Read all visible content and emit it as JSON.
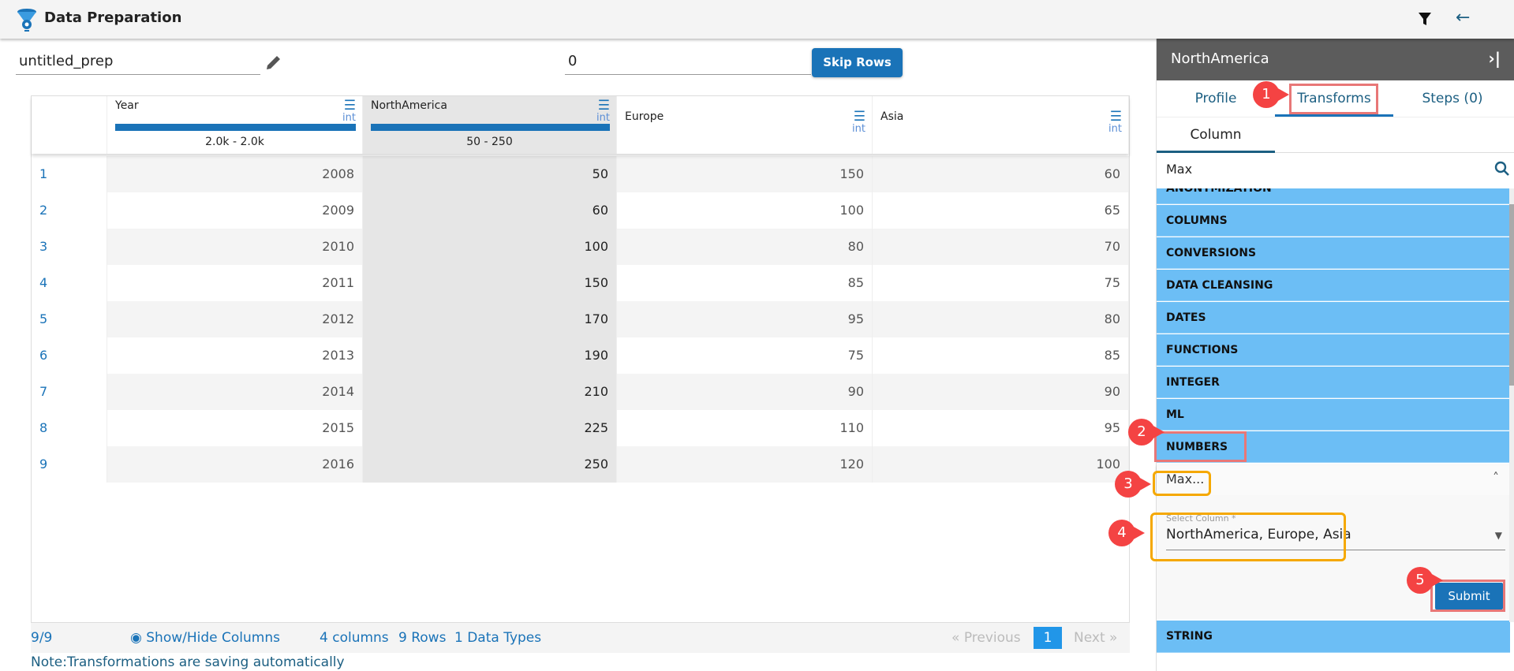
{
  "header": {
    "title": "Data Preparation",
    "icons": [
      "dataprep-logo-icon",
      "filter-icon",
      "back-arrow-icon"
    ]
  },
  "toolbar": {
    "name_value": "untitled_prep",
    "skip_value": "0",
    "skip_label": "Skip Rows"
  },
  "grid": {
    "columns": [
      {
        "name": "Year",
        "type": "int",
        "range": "2.0k - 2.0k",
        "profiled": true
      },
      {
        "name": "NorthAmerica",
        "type": "int",
        "range": "50 - 250",
        "profiled": true
      },
      {
        "name": "Europe",
        "type": "int"
      },
      {
        "name": "Asia",
        "type": "int"
      }
    ],
    "rows": [
      [
        "1",
        "2008",
        "50",
        "150",
        "60"
      ],
      [
        "2",
        "2009",
        "60",
        "100",
        "65"
      ],
      [
        "3",
        "2010",
        "100",
        "80",
        "70"
      ],
      [
        "4",
        "2011",
        "150",
        "85",
        "75"
      ],
      [
        "5",
        "2012",
        "170",
        "95",
        "80"
      ],
      [
        "6",
        "2013",
        "190",
        "75",
        "85"
      ],
      [
        "7",
        "2014",
        "210",
        "90",
        "90"
      ],
      [
        "8",
        "2015",
        "225",
        "110",
        "95"
      ],
      [
        "9",
        "2016",
        "250",
        "120",
        "100"
      ]
    ]
  },
  "footer": {
    "count": "9/9",
    "show_hide": "Show/Hide Columns",
    "columns": "4 columns",
    "rows": "9 Rows",
    "types": "1 Data Types",
    "previous": "Previous",
    "page": "1",
    "next": "Next",
    "note": "Note:Transformations are saving automatically"
  },
  "panel": {
    "title": "NorthAmerica",
    "tabs": [
      "Profile",
      "Transforms",
      "Steps (0)"
    ],
    "subtab": "Column",
    "search_value": "Max",
    "categories": [
      "ANONYMIZATION",
      "COLUMNS",
      "CONVERSIONS",
      "DATA CLEANSING",
      "DATES",
      "FUNCTIONS",
      "INTEGER",
      "ML",
      "NUMBERS"
    ],
    "transform": "Max...",
    "select_label": "Select Column *",
    "select_value": "NorthAmerica, Europe, Asia",
    "submit": "Submit",
    "last_category": "STRING"
  },
  "annotations": [
    "1",
    "2",
    "3",
    "4",
    "5"
  ],
  "colors": {
    "accent": "#1a73b8",
    "category": "#6cbef5",
    "annotation": "#f44343"
  }
}
